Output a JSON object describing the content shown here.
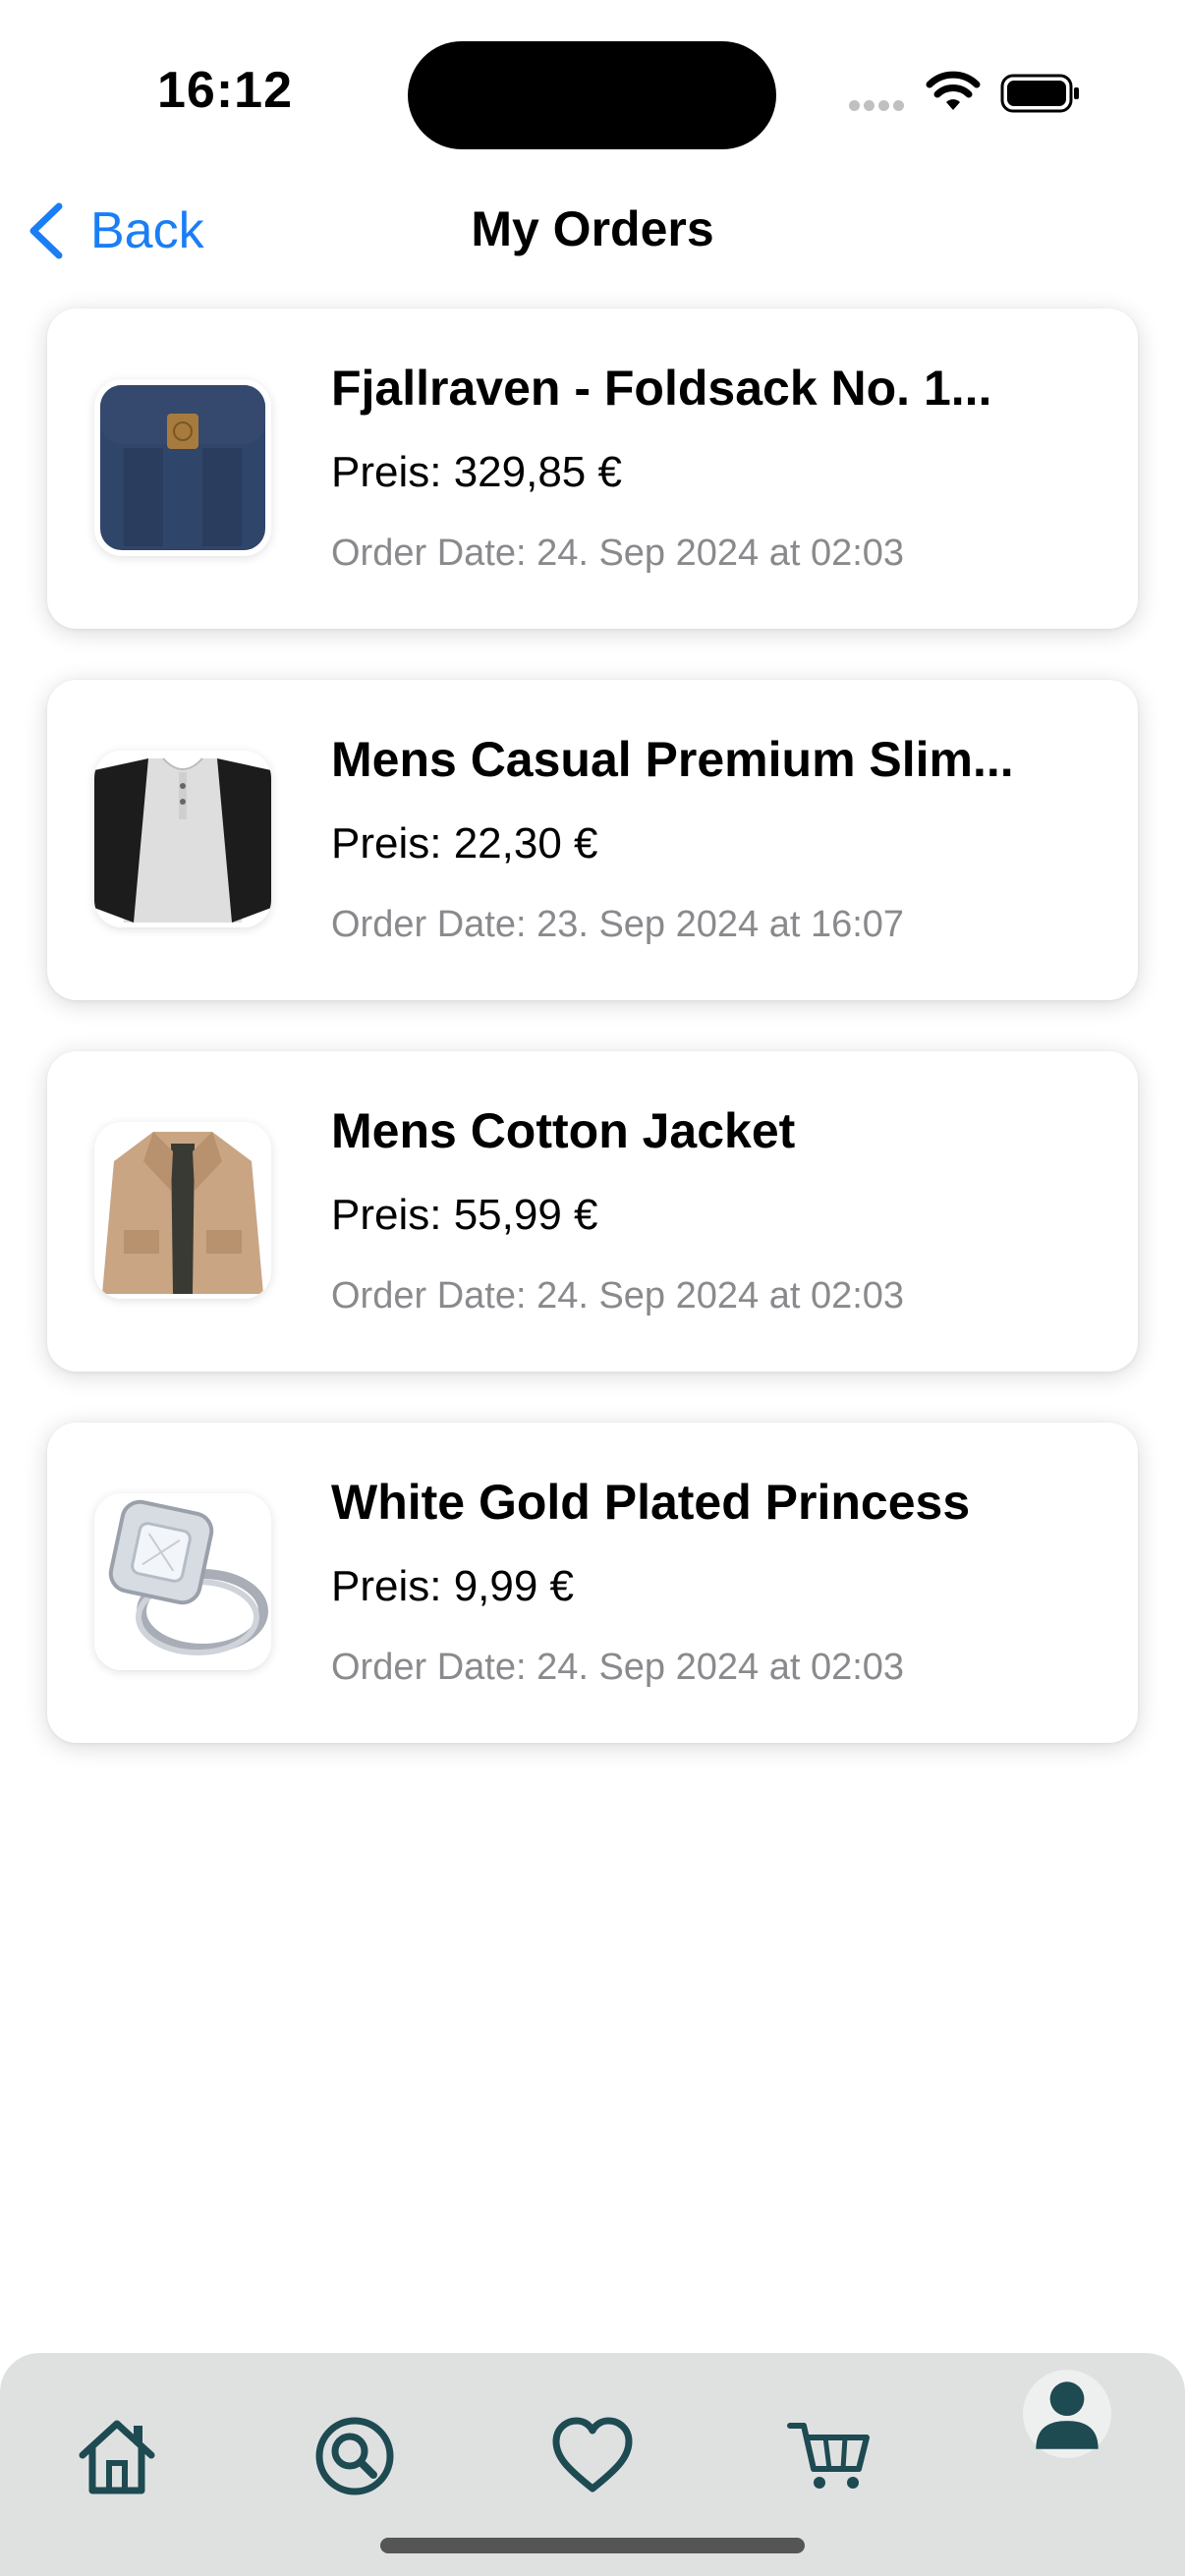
{
  "status_bar": {
    "time": "16:12"
  },
  "nav": {
    "back_label": "Back",
    "title": "My Orders"
  },
  "orders": [
    {
      "title": "Fjallraven - Foldsack No. 1...",
      "price": "Preis: 329,85 €",
      "date": "Order Date: 24. Sep 2024 at 02:03",
      "image": "backpack"
    },
    {
      "title": "Mens Casual Premium Slim...",
      "price": "Preis: 22,30 €",
      "date": "Order Date: 23. Sep 2024 at 16:07",
      "image": "tshirt"
    },
    {
      "title": "Mens Cotton Jacket",
      "price": "Preis: 55,99 €",
      "date": "Order Date: 24. Sep 2024 at 02:03",
      "image": "jacket"
    },
    {
      "title": "White Gold Plated Princess",
      "price": "Preis: 9,99 €",
      "date": "Order Date: 24. Sep 2024 at 02:03",
      "image": "ring"
    }
  ],
  "tab_bar": {
    "items": [
      "home-icon",
      "search-icon",
      "heart-icon",
      "cart-icon",
      "profile-icon"
    ],
    "selected": "profile-icon",
    "icon_color": "#1e4a52"
  },
  "colors": {
    "accent": "#1a7ef5",
    "tab_bar_bg": "#dfe1e1",
    "secondary_text": "#8a8a8e"
  }
}
